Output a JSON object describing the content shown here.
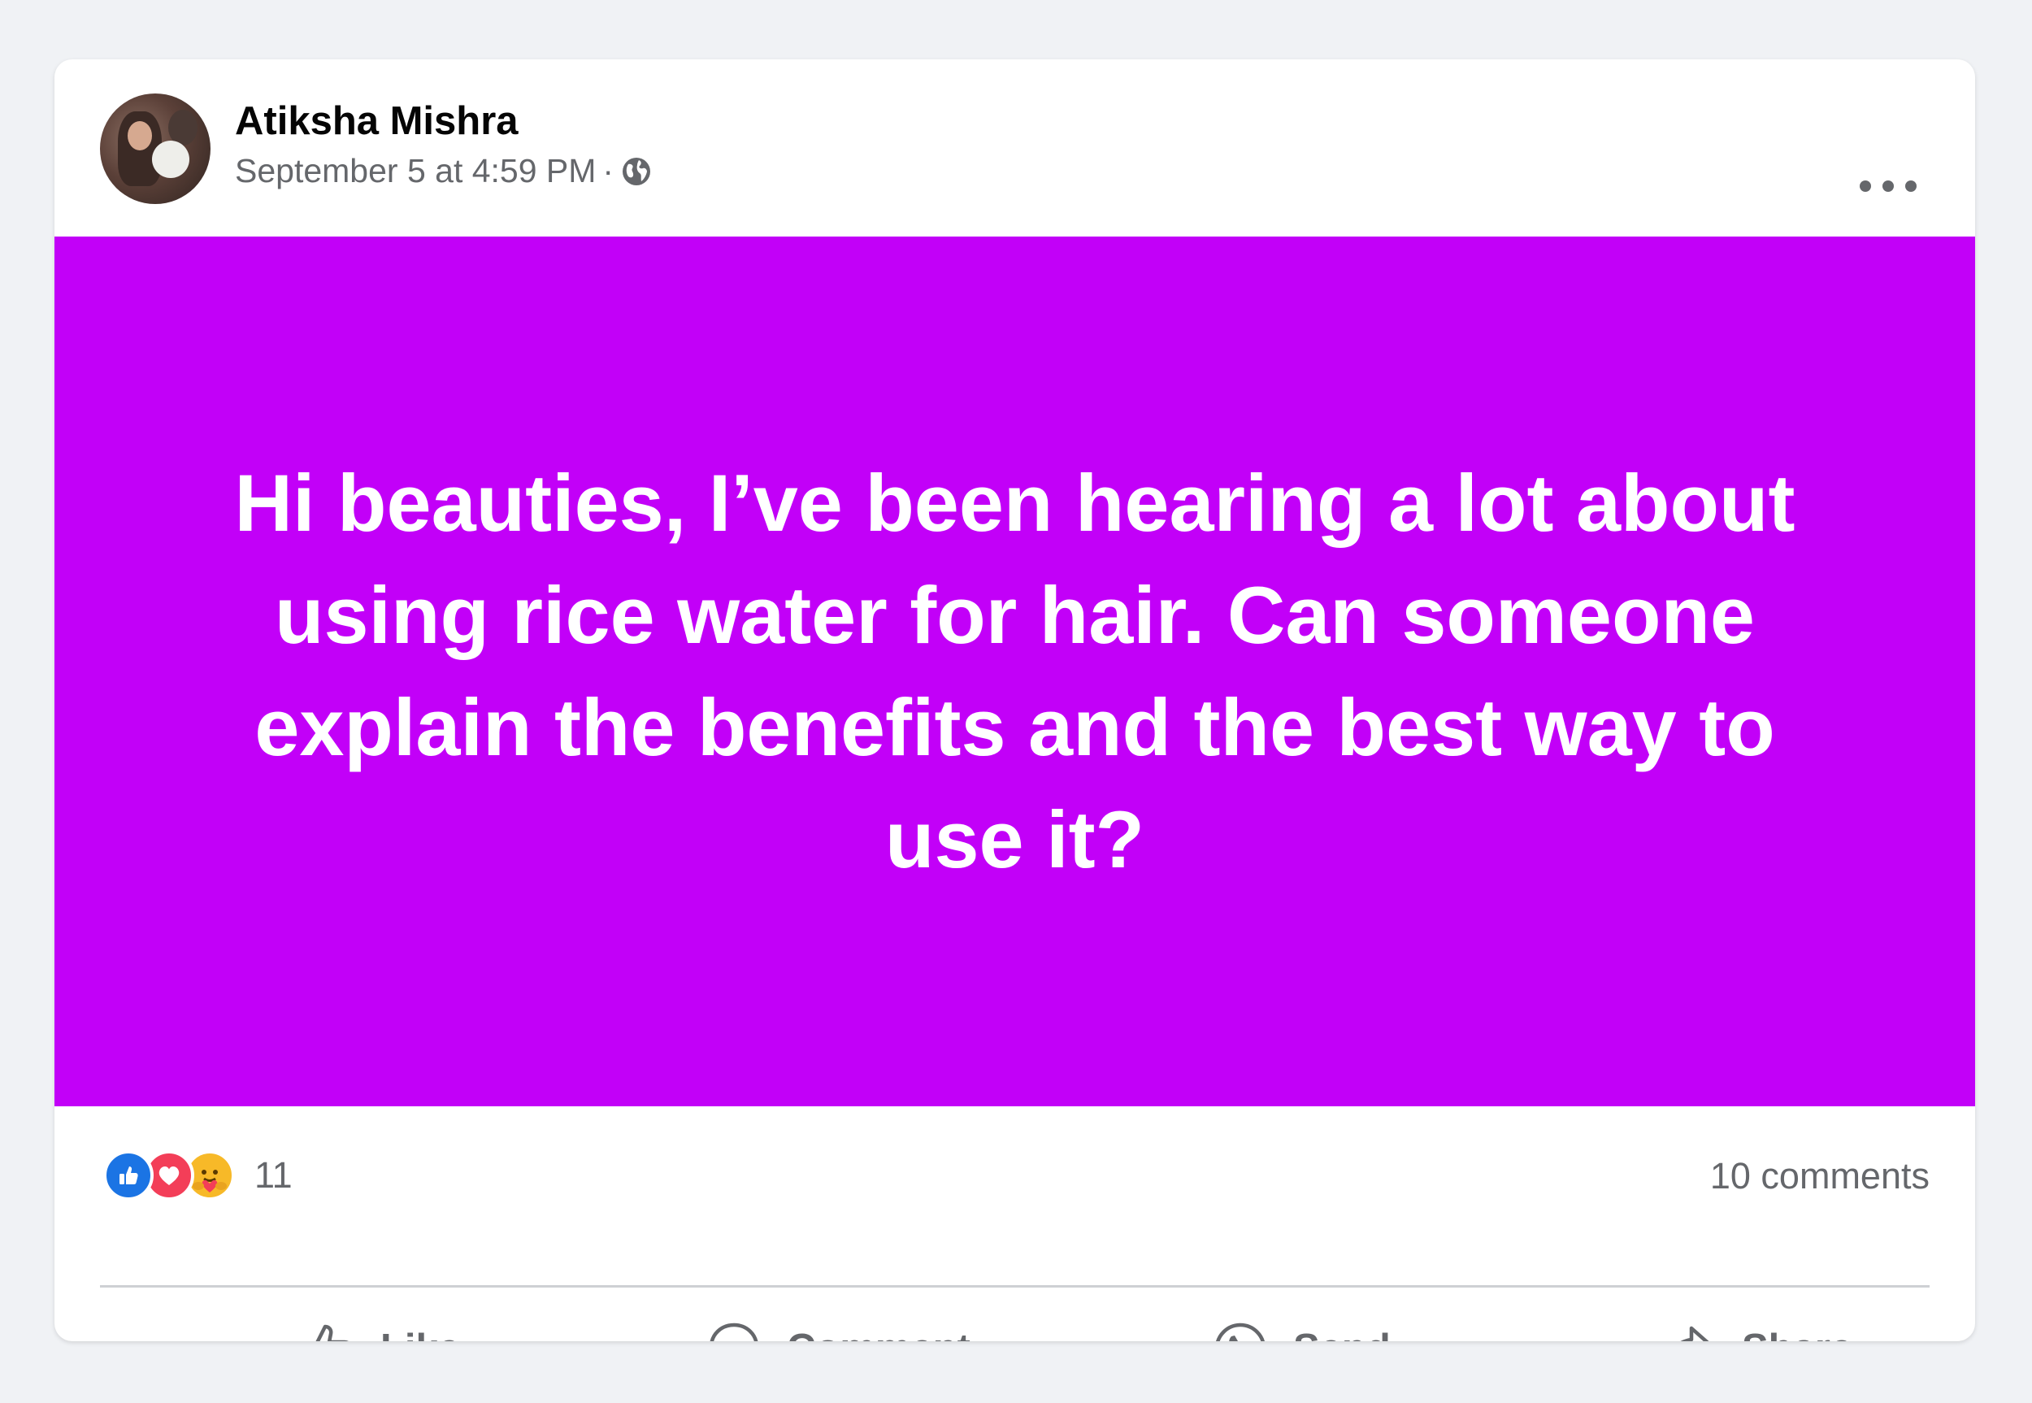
{
  "post": {
    "author_name": "Atiksha Mishra",
    "timestamp": "September 5 at 4:59 PM",
    "separator": "·",
    "privacy_icon": "globe-icon",
    "menu_icon": "more-horizontal-icon",
    "background_color": "#c200f8",
    "text": "Hi beauties, I’ve been hearing a lot about using rice water for hair. Can someone explain the benefits and the best way to use it?"
  },
  "engagement": {
    "reactions": [
      "like",
      "love",
      "care"
    ],
    "reaction_count": "11",
    "comments_label": "10 comments"
  },
  "actions": {
    "like": "Like",
    "comment": "Comment",
    "send": "Send",
    "share": "Share"
  }
}
